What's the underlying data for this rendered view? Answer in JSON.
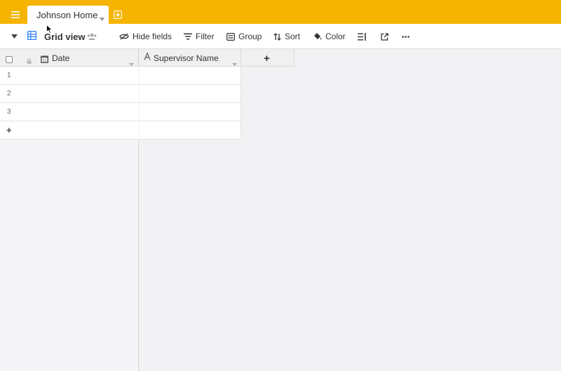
{
  "tab": {
    "title": "Johnson Home"
  },
  "toolbar": {
    "view_name": "Grid view",
    "hide_fields": "Hide fields",
    "filter": "Filter",
    "group": "Group",
    "sort": "Sort",
    "color": "Color"
  },
  "grid": {
    "columns": [
      {
        "label": "Date",
        "icon": "calendar-icon"
      },
      {
        "label": "Supervisor Name",
        "icon": "text-field-icon"
      }
    ],
    "add_column": "+",
    "rows": [
      {
        "number": "1"
      },
      {
        "number": "2"
      },
      {
        "number": "3"
      }
    ],
    "add_row": "+"
  },
  "colors": {
    "topbar": "#f5b400",
    "view_icon": "#2d7ff9"
  }
}
